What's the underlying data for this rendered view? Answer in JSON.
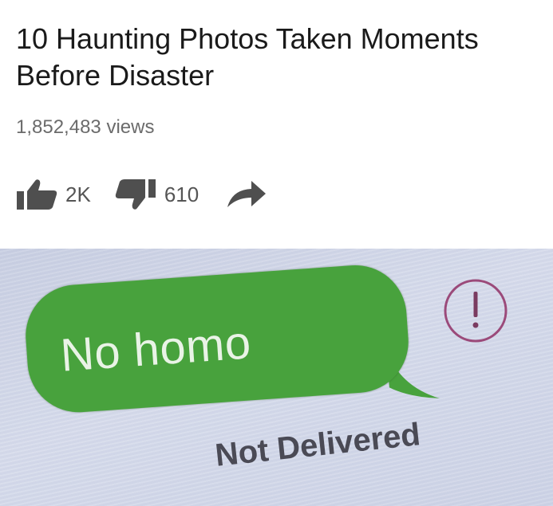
{
  "video": {
    "title": "10 Haunting Photos Taken Moments Before Disaster",
    "views": "1,852,483 views",
    "likes": "2K",
    "dislikes": "610",
    "icons": {
      "like": "thumbs-up-icon",
      "dislike": "thumbs-down-icon",
      "share": "share-arrow-icon"
    }
  },
  "message": {
    "text": "No homo",
    "status": "Not Delivered",
    "alert_icon": "exclamation-circle-icon",
    "colors": {
      "bubble": "#48a23d",
      "bubble_text": "#e9f3e6",
      "alert": "#9b4a7a",
      "screen": "#d2d7e8"
    }
  }
}
